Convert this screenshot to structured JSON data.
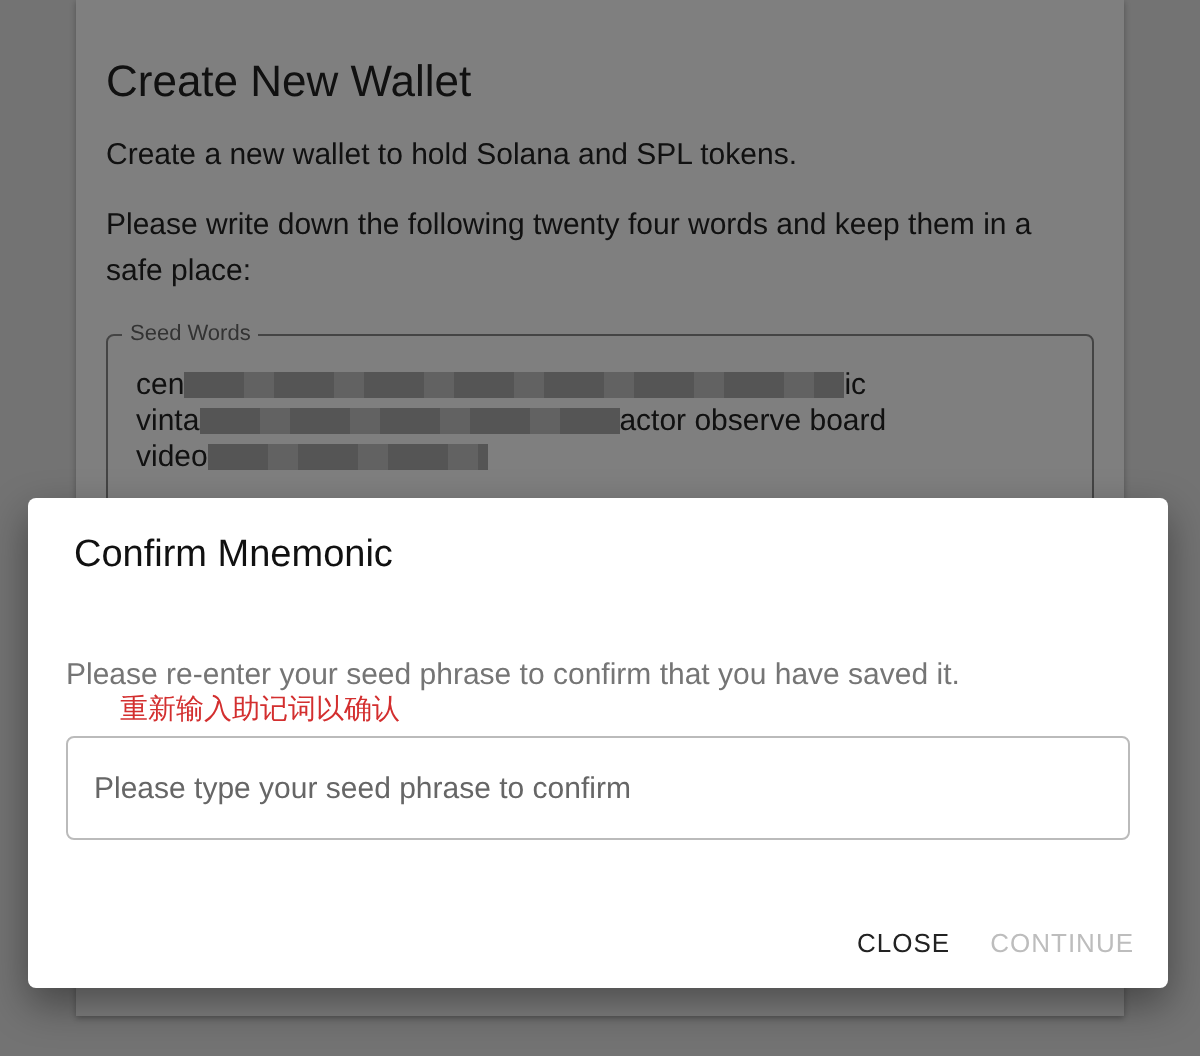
{
  "card": {
    "title": "Create New Wallet",
    "description": "Create a new wallet to hold Solana and SPL tokens.",
    "instruction": "Please write down the following twenty four words and keep them in a safe place:",
    "seed_field": {
      "label": "Seed Words",
      "lines": [
        [
          "cen",
          "ic"
        ],
        [
          "vinta",
          "actor observe board"
        ],
        [
          "video"
        ]
      ]
    }
  },
  "dialog": {
    "title": "Confirm Mnemonic",
    "description": "Please re-enter your seed phrase to confirm that you have saved it.",
    "annotation": "重新输入助记词以确认",
    "input": {
      "placeholder": "Please type your seed phrase to confirm"
    },
    "buttons": [
      {
        "label": "CLOSE",
        "disabled": false
      },
      {
        "label": "CONTINUE",
        "disabled": true
      }
    ]
  }
}
